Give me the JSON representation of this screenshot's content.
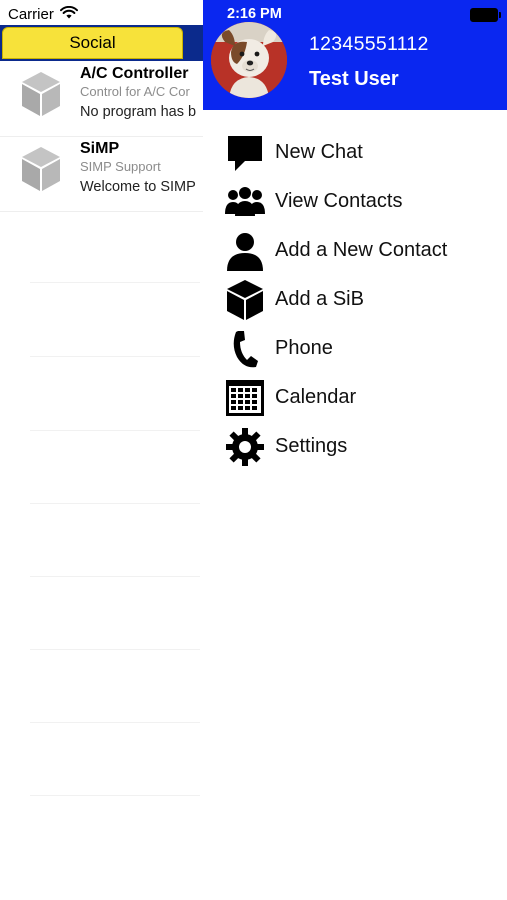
{
  "status_bar": {
    "carrier": "Carrier",
    "time": "2:16 PM"
  },
  "tabs": {
    "social": "Social"
  },
  "conversations": [
    {
      "title": "A/C Controller",
      "subtitle": "Control for A/C Cor",
      "message": "No program has b"
    },
    {
      "title": "SiMP",
      "subtitle": "SIMP Support",
      "message": "Welcome to SIMP"
    }
  ],
  "drawer": {
    "phone_number": "12345551112",
    "user_name": "Test User",
    "header_color": "#0a27f0",
    "menu": [
      {
        "label": "New Chat",
        "icon": "chat-bubble-icon"
      },
      {
        "label": "View Contacts",
        "icon": "group-icon"
      },
      {
        "label": "Add a New Contact",
        "icon": "person-icon"
      },
      {
        "label": "Add a SiB",
        "icon": "cube-icon"
      },
      {
        "label": "Phone",
        "icon": "phone-icon"
      },
      {
        "label": "Calendar",
        "icon": "calendar-icon"
      },
      {
        "label": "Settings",
        "icon": "gear-icon"
      }
    ]
  }
}
